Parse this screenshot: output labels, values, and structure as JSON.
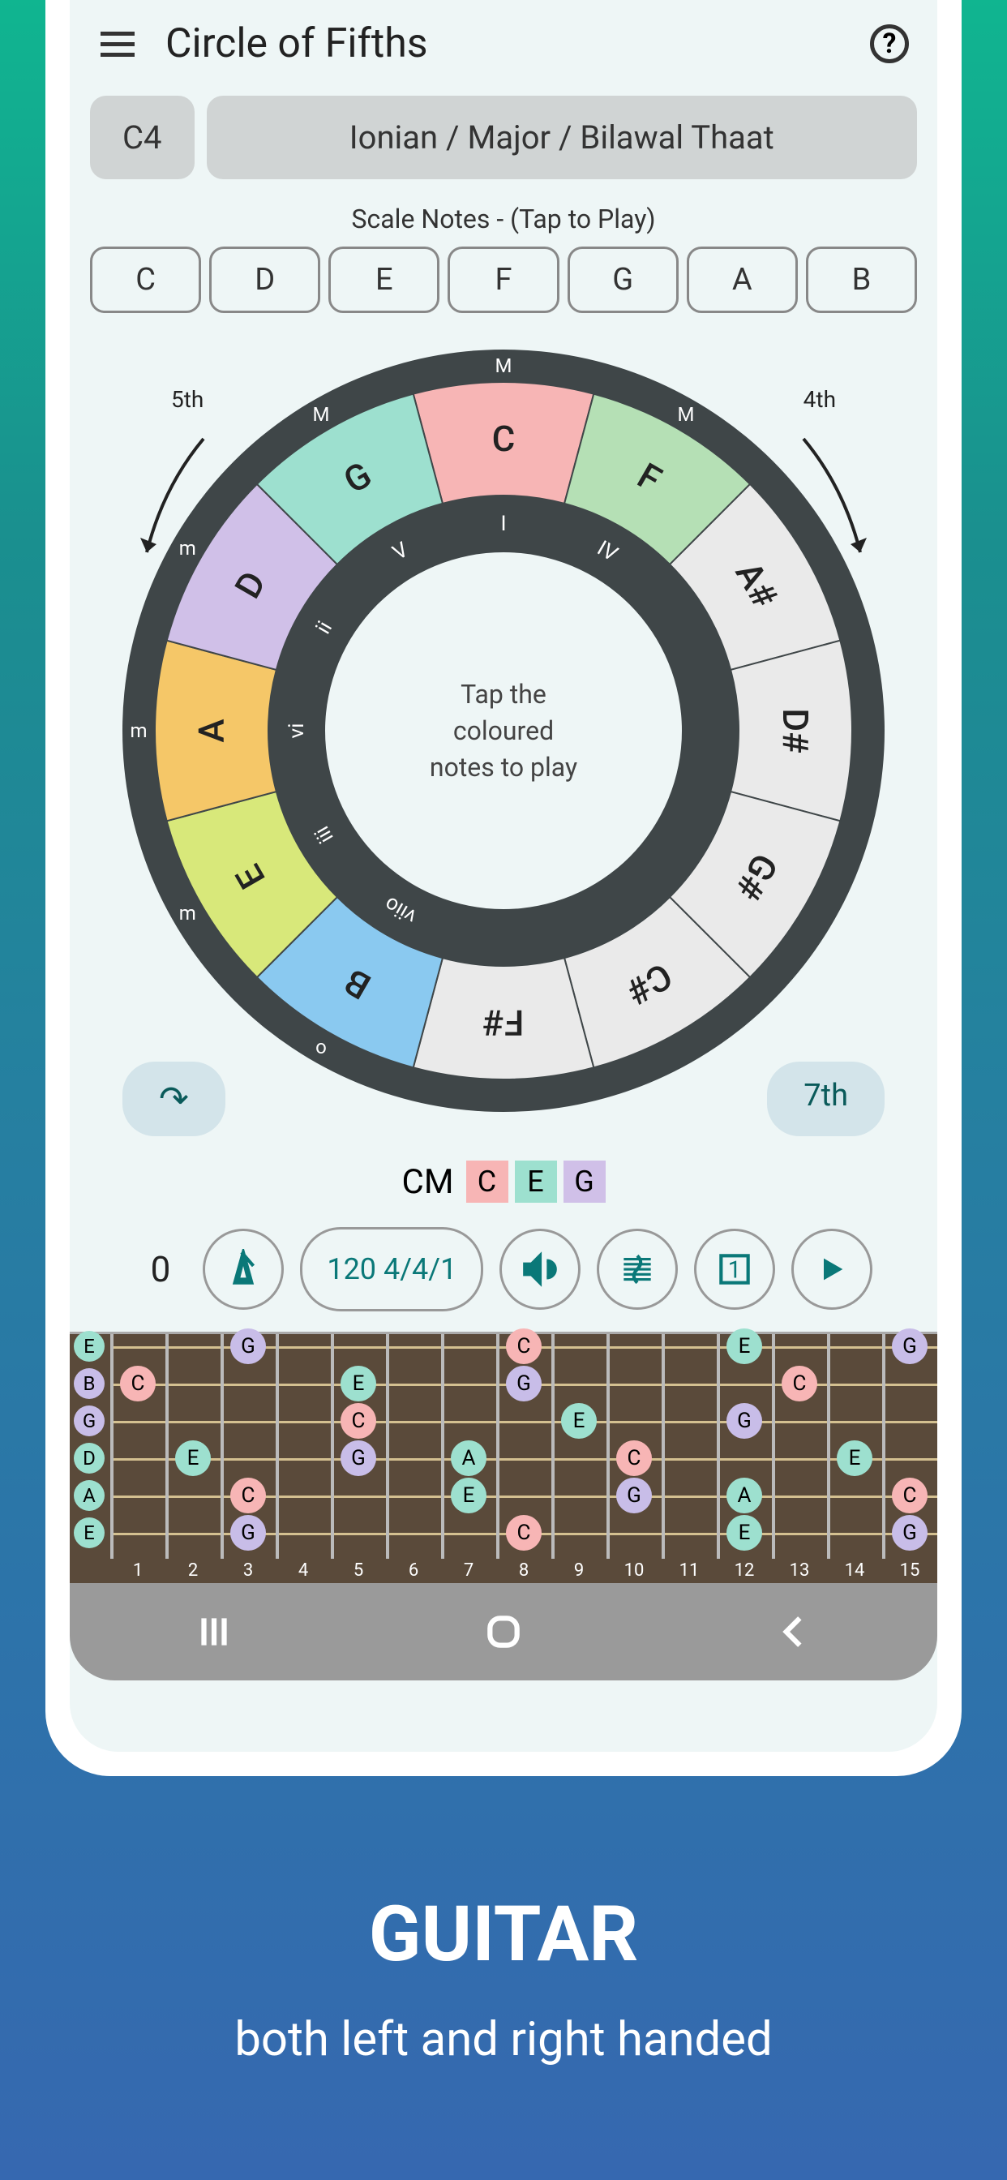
{
  "header": {
    "title": "Circle of Fifths"
  },
  "key_pill": "C4",
  "scale_pill": "Ionian / Major / Bilawal Thaat",
  "scale_label": "Scale Notes - (Tap to Play)",
  "scale_notes": [
    "C",
    "D",
    "E",
    "F",
    "G",
    "A",
    "B"
  ],
  "arc_left": "5th",
  "arc_right": "4th",
  "center_text": "Tap the\ncoloured\nnotes to play",
  "wedges": [
    {
      "note": "C",
      "angle": 0,
      "color": "#f7b5b5",
      "outer": "M",
      "inner": "I"
    },
    {
      "note": "F",
      "angle": 30,
      "color": "#b5e0b5",
      "outer": "M",
      "inner": "IV"
    },
    {
      "note": "A#",
      "angle": 60,
      "color": "#eaeaea",
      "outer": "",
      "inner": ""
    },
    {
      "note": "D#",
      "angle": 90,
      "color": "#eaeaea",
      "outer": "",
      "inner": ""
    },
    {
      "note": "G#",
      "angle": 120,
      "color": "#eaeaea",
      "outer": "",
      "inner": ""
    },
    {
      "note": "C#",
      "angle": 150,
      "color": "#eaeaea",
      "outer": "",
      "inner": ""
    },
    {
      "note": "F#",
      "angle": 180,
      "color": "#eaeaea",
      "outer": "",
      "inner": ""
    },
    {
      "note": "B",
      "angle": 210,
      "color": "#8ac9f0",
      "outer": "o",
      "inner": "viio"
    },
    {
      "note": "E",
      "angle": 240,
      "color": "#d8e87a",
      "outer": "m",
      "inner": "iii"
    },
    {
      "note": "A",
      "angle": 270,
      "color": "#f5c768",
      "outer": "m",
      "inner": "vi"
    },
    {
      "note": "D",
      "angle": 300,
      "color": "#d0c0e8",
      "outer": "m",
      "inner": "ii"
    },
    {
      "note": "G",
      "angle": 330,
      "color": "#9de0cf",
      "outer": "M",
      "inner": "V"
    }
  ],
  "pill_left": "↷",
  "pill_right": "7th",
  "chord": {
    "name": "CM",
    "tones": [
      {
        "t": "C",
        "bg": "#f7b5b5"
      },
      {
        "t": "E",
        "bg": "#9de0cf"
      },
      {
        "t": "G",
        "bg": "#d0c0e8"
      }
    ]
  },
  "controls": {
    "num": "0",
    "tempo": "120 4/4/1"
  },
  "fretboard": {
    "open": [
      {
        "s": 0,
        "t": "E",
        "bg": "#9de0cf"
      },
      {
        "s": 1,
        "t": "B",
        "bg": "#c8bde8"
      },
      {
        "s": 2,
        "t": "G",
        "bg": "#c8bde8"
      },
      {
        "s": 3,
        "t": "D",
        "bg": "#9de0cf"
      },
      {
        "s": 4,
        "t": "A",
        "bg": "#9de0cf"
      },
      {
        "s": 5,
        "t": "E",
        "bg": "#9de0cf"
      }
    ],
    "notes": [
      {
        "f": 1,
        "s": 1,
        "t": "C",
        "bg": "#f7b5b5"
      },
      {
        "f": 2,
        "s": 3,
        "t": "E",
        "bg": "#9de0cf"
      },
      {
        "f": 3,
        "s": 0,
        "t": "G",
        "bg": "#c8bde8"
      },
      {
        "f": 3,
        "s": 4,
        "t": "C",
        "bg": "#f7b5b5"
      },
      {
        "f": 3,
        "s": 5,
        "t": "G",
        "bg": "#c8bde8"
      },
      {
        "f": 5,
        "s": 1,
        "t": "E",
        "bg": "#9de0cf"
      },
      {
        "f": 5,
        "s": 2,
        "t": "C",
        "bg": "#f7b5b5"
      },
      {
        "f": 5,
        "s": 3,
        "t": "G",
        "bg": "#c8bde8"
      },
      {
        "f": 7,
        "s": 3,
        "t": "A",
        "bg": "#9de0cf"
      },
      {
        "f": 7,
        "s": 4,
        "t": "E",
        "bg": "#9de0cf"
      },
      {
        "f": 8,
        "s": 0,
        "t": "C",
        "bg": "#f7b5b5"
      },
      {
        "f": 8,
        "s": 1,
        "t": "G",
        "bg": "#c8bde8"
      },
      {
        "f": 8,
        "s": 5,
        "t": "C",
        "bg": "#f7b5b5"
      },
      {
        "f": 9,
        "s": 2,
        "t": "E",
        "bg": "#9de0cf"
      },
      {
        "f": 10,
        "s": 3,
        "t": "C",
        "bg": "#f7b5b5"
      },
      {
        "f": 10,
        "s": 4,
        "t": "G",
        "bg": "#c8bde8"
      },
      {
        "f": 12,
        "s": 0,
        "t": "E",
        "bg": "#9de0cf"
      },
      {
        "f": 12,
        "s": 2,
        "t": "G",
        "bg": "#c8bde8"
      },
      {
        "f": 12,
        "s": 4,
        "t": "A",
        "bg": "#9de0cf"
      },
      {
        "f": 12,
        "s": 5,
        "t": "E",
        "bg": "#9de0cf"
      },
      {
        "f": 13,
        "s": 1,
        "t": "C",
        "bg": "#f7b5b5"
      },
      {
        "f": 14,
        "s": 3,
        "t": "E",
        "bg": "#9de0cf"
      },
      {
        "f": 15,
        "s": 0,
        "t": "G",
        "bg": "#c8bde8"
      },
      {
        "f": 15,
        "s": 4,
        "t": "C",
        "bg": "#f7b5b5"
      },
      {
        "f": 15,
        "s": 5,
        "t": "G",
        "bg": "#c8bde8"
      }
    ],
    "frets": 15
  },
  "promo": {
    "title": "GUITAR",
    "sub": "both left and right handed"
  }
}
